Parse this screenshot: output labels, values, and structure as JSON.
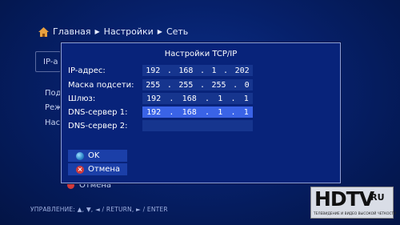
{
  "breadcrumb": {
    "home": "Главная",
    "settings": "Настройки",
    "network": "Сеть"
  },
  "background": {
    "ip_partial": "IP-а",
    "item1": "Под",
    "item2": "Реж",
    "item3": "Наст",
    "cancel_label": "Отмена"
  },
  "dialog": {
    "title": "Настройки TCP/IP",
    "rows": [
      {
        "label": "IP-адрес:",
        "octets": [
          "192",
          "168",
          "1",
          "202"
        ]
      },
      {
        "label": "Маска подсети:",
        "octets": [
          "255",
          "255",
          "255",
          "0"
        ]
      },
      {
        "label": "Шлюз:",
        "octets": [
          "192",
          "168",
          "1",
          "1"
        ]
      },
      {
        "label": "DNS-сервер 1:",
        "octets": [
          "192",
          "168",
          "1",
          "1"
        ]
      },
      {
        "label": "DNS-сервер 2:",
        "octets": []
      }
    ],
    "ok_label": "OK",
    "cancel_label": "Отмена"
  },
  "footer": {
    "hint": "УПРАВЛЕНИЕ: ▲, ▼, ◄ / RETURN, ► / ENTER"
  },
  "logo": {
    "main": "HDTV",
    "ru": ".RU",
    "tagline": "ТЕЛЕВИДЕНИЕ И ВИДЕО ВЫСОКОЙ ЧЕТКОСТИ"
  },
  "colors": {
    "active_field": "#3a63e6",
    "field": "#16358e",
    "dialog_bg": "#08237a"
  }
}
